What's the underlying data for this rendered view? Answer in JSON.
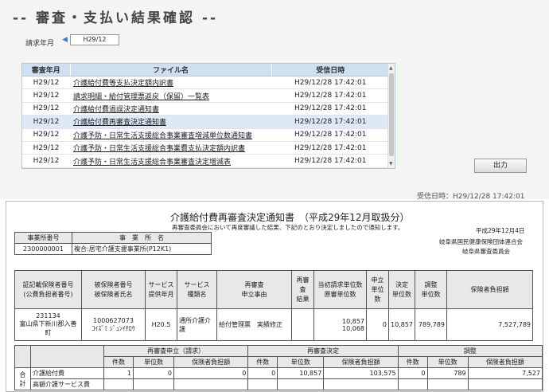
{
  "page_title": "-- 審査・支払い結果確認 --",
  "billing_month": {
    "label": "請求年月",
    "prev_arrow": "◀",
    "value": "H29/12",
    "next_arrow": "▶"
  },
  "file_list": {
    "headers": [
      "審査年月",
      "ファイル名",
      "受信日時"
    ],
    "rows": [
      {
        "year": "H29/12",
        "name": "介護給付費等支払決定額内訳書",
        "received": "H29/12/28 17:42:01"
      },
      {
        "year": "H29/12",
        "name": "請求明細・給付管理票返戻（保留）一覧表",
        "received": "H29/12/28 17:42:01"
      },
      {
        "year": "H29/12",
        "name": "介護給付費過誤決定通知書",
        "received": "H29/12/28 17:42:01"
      },
      {
        "year": "H29/12",
        "name": "介護給付費再審査決定通知書",
        "received": "H29/12/28 17:42:01"
      },
      {
        "year": "H29/12",
        "name": "介護予防・日常生活支援総合事業審査増減単位数通知書",
        "received": "H29/12/28 17:42:01"
      },
      {
        "year": "H29/12",
        "name": "介護予防・日常生活支援総合事業費支払決定額内訳書",
        "received": "H29/12/28 17:42:01"
      },
      {
        "year": "H29/12",
        "name": "介護予防・日常生活支援総合事業審査決定増減表",
        "received": "H29/12/28 17:42:01"
      }
    ],
    "selected_index": 3,
    "scroll_up": "▲",
    "scroll_down": "▼"
  },
  "output_button": "出力",
  "received_datetime": "受信日時：H29/12/28 17:42:01",
  "document": {
    "title": "介護給付費再審査決定通知書　（平成29年12月取扱分）",
    "subtitle": "再審査委員会において再度審議した結果、下記のとおり決定しましたので通知します。",
    "date": "平成29年12月4日",
    "org1": "岐阜県国民健康保険団体連合会",
    "org2": "岐阜県審査委員会",
    "office": {
      "headers": [
        "事業所番号",
        "事　業　所　名"
      ],
      "number": "2300000001",
      "name": "複合:居宅介護支援事業所(P12K1)"
    },
    "detail": {
      "headers": [
        "証記載保険者番号\n(公費負担者番号)",
        "被保険者番号\n被保険者氏名",
        "サービス\n提供年月",
        "サービス\n種類名",
        "再審査\n申立事由",
        "再審査\n結果",
        "当初請求単位数\n原審単位数",
        "申立\n単位数",
        "決定\n単位数",
        "調整\n単位数",
        "保険者負担額"
      ],
      "insurer_no": "231134",
      "insurer_name": "富山県下新川郡入善町",
      "insured_no": "1000627073",
      "insured_name": "ｺｲｽﾞﾐ ｼﾞｭﾝｲﾁﾛｳ",
      "service_month": "H20.5",
      "service_type": "通所介護介護",
      "reason": "給付管理票　実績修正",
      "result": "",
      "initial_units": "10,857",
      "original_units": "10,068",
      "claim_units": "0",
      "decision_units": "10,857",
      "adjust_units": "789,789",
      "insurer_amount": "7,527,789"
    },
    "summary": {
      "group_headers": [
        "再審査申立（請求）",
        "再審査決定",
        "調整"
      ],
      "sub_headers": [
        "件数",
        "単位数",
        "保険者負担額",
        "件数",
        "単位数",
        "保険者負担額",
        "件数",
        "単位数",
        "保険者負担額"
      ],
      "total_label": "合計",
      "row_label": "介護給付費",
      "values": [
        "1",
        "0",
        "0",
        "0",
        "10,857",
        "103,575",
        "0",
        "789",
        "7,527"
      ],
      "row2_label": "高額介護サービス費"
    }
  }
}
